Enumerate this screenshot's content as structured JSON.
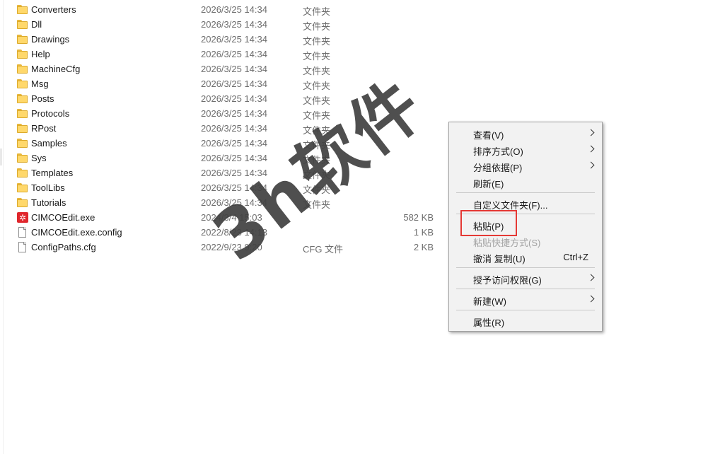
{
  "files": [
    {
      "name": "Converters",
      "date": "2026/3/25 14:34",
      "type": "文件夹",
      "size": "",
      "icon": "folder-icon"
    },
    {
      "name": "Dll",
      "date": "2026/3/25 14:34",
      "type": "文件夹",
      "size": "",
      "icon": "folder-icon"
    },
    {
      "name": "Drawings",
      "date": "2026/3/25 14:34",
      "type": "文件夹",
      "size": "",
      "icon": "folder-icon"
    },
    {
      "name": "Help",
      "date": "2026/3/25 14:34",
      "type": "文件夹",
      "size": "",
      "icon": "folder-icon"
    },
    {
      "name": "MachineCfg",
      "date": "2026/3/25 14:34",
      "type": "文件夹",
      "size": "",
      "icon": "folder-icon"
    },
    {
      "name": "Msg",
      "date": "2026/3/25 14:34",
      "type": "文件夹",
      "size": "",
      "icon": "folder-icon"
    },
    {
      "name": "Posts",
      "date": "2026/3/25 14:34",
      "type": "文件夹",
      "size": "",
      "icon": "folder-icon"
    },
    {
      "name": "Protocols",
      "date": "2026/3/25 14:34",
      "type": "文件夹",
      "size": "",
      "icon": "folder-icon"
    },
    {
      "name": "RPost",
      "date": "2026/3/25 14:34",
      "type": "文件夹",
      "size": "",
      "icon": "folder-icon"
    },
    {
      "name": "Samples",
      "date": "2026/3/25 14:34",
      "type": "文件夹",
      "size": "",
      "icon": "folder-icon"
    },
    {
      "name": "Sys",
      "date": "2026/3/25 14:34",
      "type": "文件夹",
      "size": "",
      "icon": "folder-icon"
    },
    {
      "name": "Templates",
      "date": "2026/3/25 14:34",
      "type": "文件夹",
      "size": "",
      "icon": "folder-icon"
    },
    {
      "name": "ToolLibs",
      "date": "2026/3/25 14:34",
      "type": "文件夹",
      "size": "",
      "icon": "folder-icon"
    },
    {
      "name": "Tutorials",
      "date": "2026/3/25 14:34",
      "type": "文件夹",
      "size": "",
      "icon": "folder-icon"
    },
    {
      "name": "CIMCOEdit.exe",
      "date": "2024/3/4 15:03",
      "type": "",
      "size": "582 KB",
      "icon": "cimco-app-icon"
    },
    {
      "name": "CIMCOEdit.exe.config",
      "date": "2022/8/23 14:13",
      "type": "",
      "size": "1 KB",
      "icon": "document-icon"
    },
    {
      "name": "ConfigPaths.cfg",
      "date": "2022/9/23 9:20",
      "type": "CFG 文件",
      "size": "2 KB",
      "icon": "document-icon"
    }
  ],
  "context_menu": {
    "view": {
      "label": "查看(V)"
    },
    "sort_by": {
      "label": "排序方式(O)"
    },
    "group_by": {
      "label": "分组依据(P)"
    },
    "refresh": {
      "label": "刷新(E)"
    },
    "customize_folder": {
      "label": "自定义文件夹(F)..."
    },
    "paste": {
      "label": "粘贴(P)"
    },
    "paste_shortcut": {
      "label": "粘贴快捷方式(S)"
    },
    "undo_copy": {
      "label": "撤消 复制(U)",
      "shortcut": "Ctrl+Z"
    },
    "grant_access": {
      "label": "授予访问权限(G)"
    },
    "new": {
      "label": "新建(W)"
    },
    "properties": {
      "label": "属性(R)"
    }
  },
  "watermark": {
    "text": "3h软件"
  },
  "colors": {
    "highlight_border": "#e53935",
    "folder": "#ffd86b",
    "menu_bg": "#f2f2f2"
  }
}
